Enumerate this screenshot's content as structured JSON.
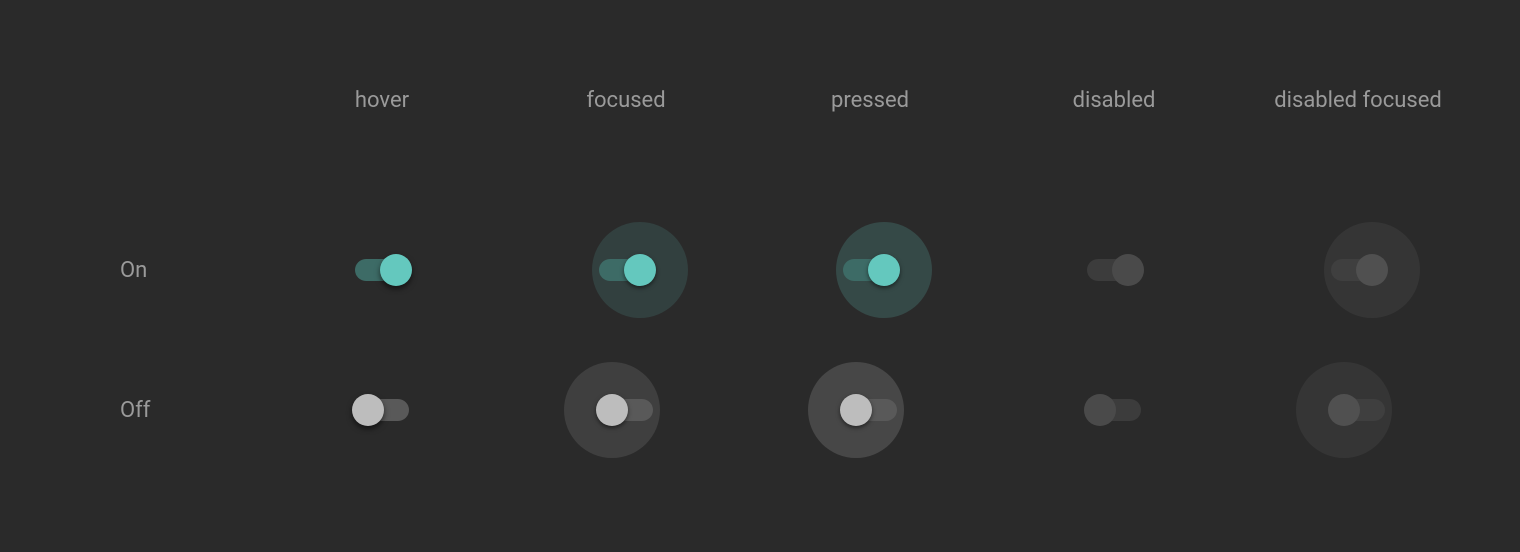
{
  "columns": {
    "hover": "hover",
    "focused": "focused",
    "pressed": "pressed",
    "disabled": "disabled",
    "disabled_focused": "disabled focused"
  },
  "rows": {
    "on": "On",
    "off": "Off"
  },
  "colors": {
    "background": "#2a2a2a",
    "label": "#9a9a9a",
    "on_track": "#3d6b66",
    "on_thumb": "#64c8be",
    "off_track": "#595959",
    "off_thumb": "#bdbdbd",
    "disabled_track": "#3c3c3c",
    "disabled_thumb": "#4a4a4a"
  }
}
